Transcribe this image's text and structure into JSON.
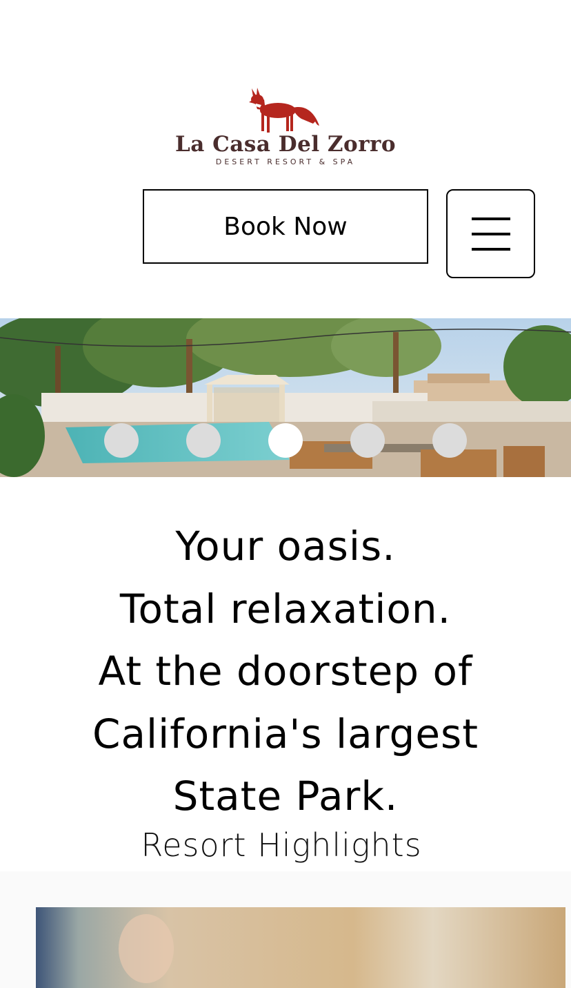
{
  "header": {
    "logo": {
      "name": "La Casa Del Zorro",
      "subtitle": "DESERT RESORT & SPA",
      "fox_color": "#b5261e",
      "text_color": "#4a2d2d"
    },
    "book_now_label": "Book Now",
    "menu_icon": "hamburger-menu-icon"
  },
  "hero_slider": {
    "slide_count": 5,
    "active_slide_index": 2
  },
  "main": {
    "tagline_lines": [
      "Your oasis.",
      "Total relaxation.",
      "At the doorstep of",
      "California's largest",
      "State Park."
    ],
    "section_title": "Resort Highlights"
  }
}
